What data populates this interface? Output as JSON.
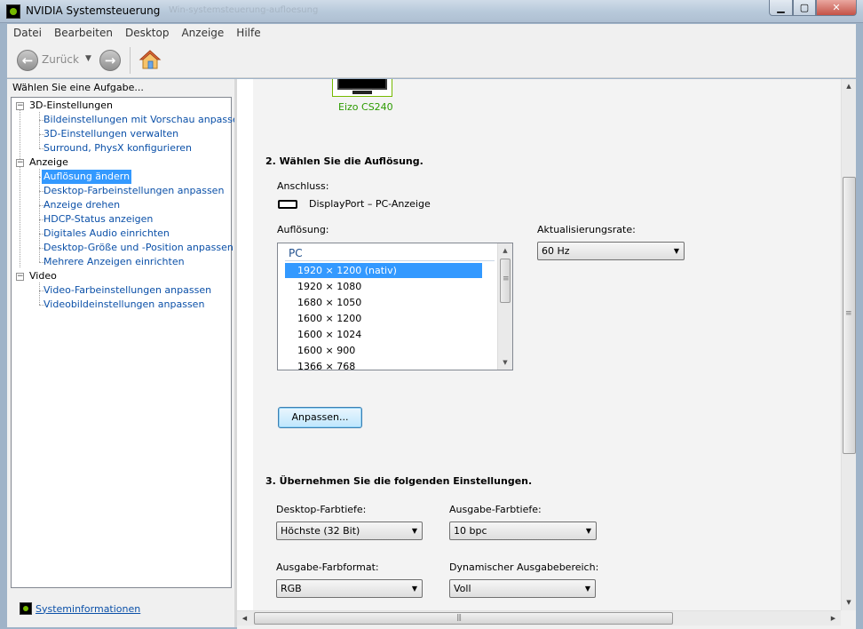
{
  "window": {
    "title": "NVIDIA Systemsteuerung",
    "ghost_title": "Win-systemsteuerung-aufloesung"
  },
  "menu": [
    "Datei",
    "Bearbeiten",
    "Desktop",
    "Anzeige",
    "Hilfe"
  ],
  "toolbar": {
    "back_label": "Zurück"
  },
  "sidebar": {
    "task_heading": "Wählen Sie eine Aufgabe...",
    "groups": [
      {
        "label": "3D-Einstellungen",
        "items": [
          "Bildeinstellungen mit Vorschau anpassen",
          "3D-Einstellungen verwalten",
          "Surround, PhysX konfigurieren"
        ]
      },
      {
        "label": "Anzeige",
        "items": [
          "Auflösung ändern",
          "Desktop-Farbeinstellungen anpassen",
          "Anzeige drehen",
          "HDCP-Status anzeigen",
          "Digitales Audio einrichten",
          "Desktop-Größe und -Position anpassen",
          "Mehrere Anzeigen einrichten"
        ]
      },
      {
        "label": "Video",
        "items": [
          "Video-Farbeinstellungen anpassen",
          "Videobildeinstellungen anpassen"
        ]
      }
    ],
    "selected": "Auflösung ändern",
    "sysinfo_link": "Systeminformationen"
  },
  "main": {
    "monitor_label": "Eizo CS240",
    "section2_heading": "2. Wählen Sie die Auflösung.",
    "connection_label": "Anschluss:",
    "connection_value": "DisplayPort – PC-Anzeige",
    "resolution_label": "Auflösung:",
    "resolution_group": "PC",
    "resolutions": [
      "1920 × 1200 (nativ)",
      "1920 × 1080",
      "1680 × 1050",
      "1600 × 1200",
      "1600 × 1024",
      "1600 × 900",
      "1366 × 768"
    ],
    "selected_resolution": "1920 × 1200 (nativ)",
    "refresh_label": "Aktualisierungsrate:",
    "refresh_value": "60 Hz",
    "customize_button": "Anpassen...",
    "section3_heading": "3. Übernehmen Sie die folgenden Einstellungen.",
    "desktop_color_depth_label": "Desktop-Farbtiefe:",
    "desktop_color_depth_value": "Höchste (32 Bit)",
    "output_color_depth_label": "Ausgabe-Farbtiefe:",
    "output_color_depth_value": "10 bpc",
    "output_color_format_label": "Ausgabe-Farbformat:",
    "output_color_format_value": "RGB",
    "dynamic_range_label": "Dynamischer Ausgabebereich:",
    "dynamic_range_value": "Voll"
  },
  "colors": {
    "nvidia_green": "#76b900",
    "link_blue": "#0b50a8",
    "selection": "#3399ff"
  }
}
